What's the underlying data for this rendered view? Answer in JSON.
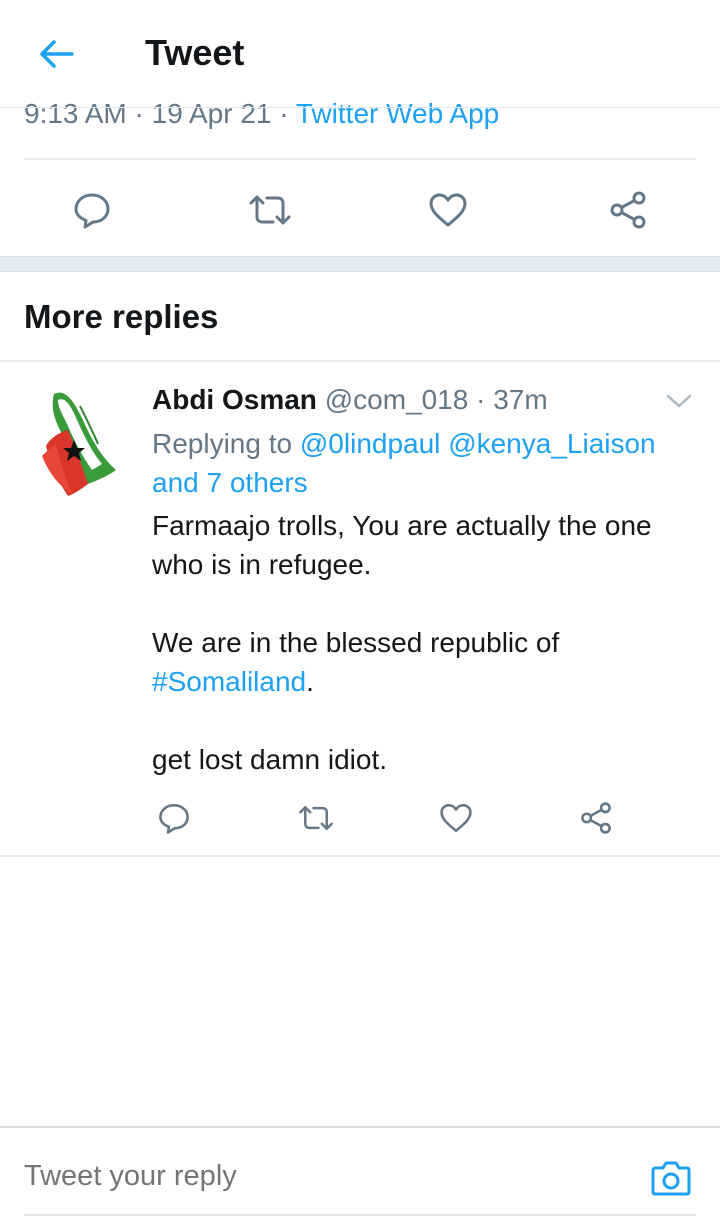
{
  "header": {
    "title": "Tweet",
    "back_icon": "arrow-left-icon",
    "accent": "#1da1f2"
  },
  "tweet_meta": {
    "time": "9:13 AM",
    "sep1": " · ",
    "date": "19 Apr 21",
    "sep2": " · ",
    "source": "Twitter Web App"
  },
  "main_actions": [
    "reply-icon",
    "retweet-icon",
    "like-icon",
    "share-icon"
  ],
  "more_replies": {
    "title": "More replies"
  },
  "reply": {
    "name": "Abdi Osman",
    "handle": "@com_018",
    "sep": " · ",
    "time": "37m",
    "replying_prefix": "Replying to ",
    "mention1": "@0lindpaul",
    "mention2": "@kenya_Liaison",
    "mention3": "and 7 others",
    "line1": "Farmaajo trolls, You are actually the one",
    "line2": "who is in refugee.",
    "line3": "We are in the blessed republic of",
    "hashtag": "#Somaliland",
    "hashtag_suffix": ".",
    "line4": "get lost damn idiot."
  },
  "composer": {
    "placeholder": "Tweet your reply",
    "camera_icon": "camera-icon"
  },
  "colors": {
    "link": "#1da1f2",
    "secondary_text": "#657786",
    "primary_text": "#14171a",
    "icon_gray": "#657786"
  }
}
